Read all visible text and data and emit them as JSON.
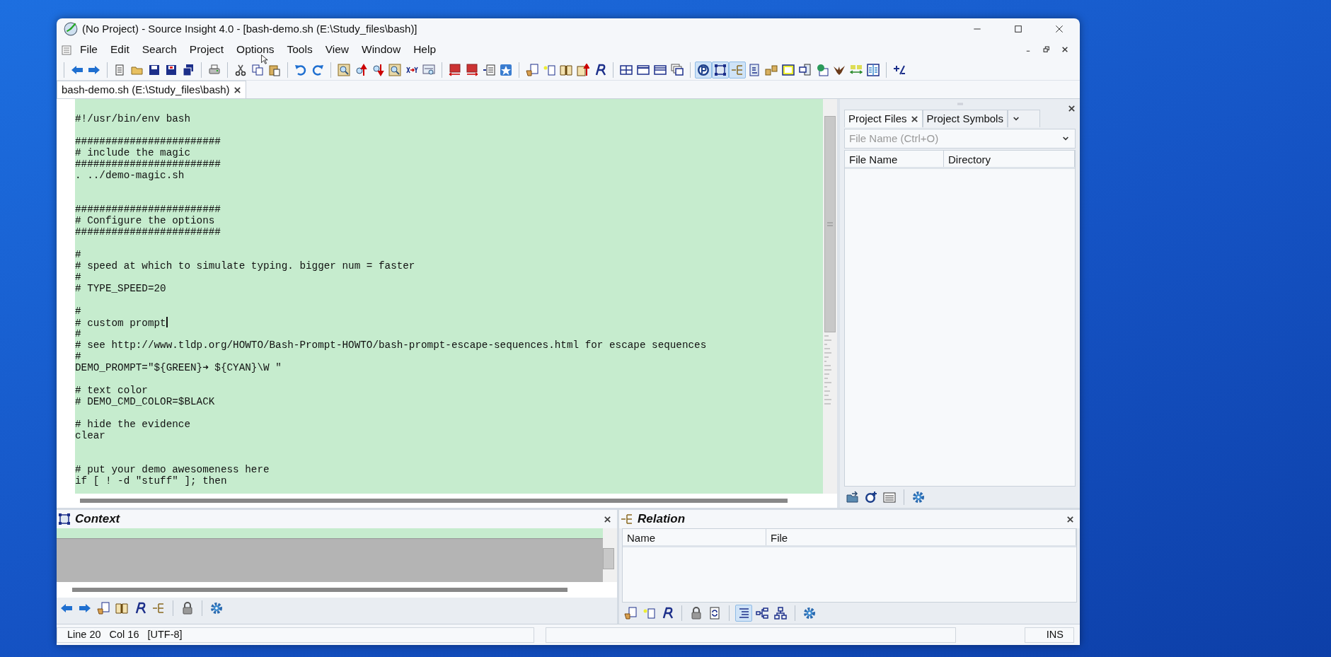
{
  "window": {
    "title": "(No Project) - Source Insight 4.0 - [bash-demo.sh (E:\\Study_files\\bash)]"
  },
  "menu": [
    "File",
    "Edit",
    "Search",
    "Project",
    "Options",
    "Tools",
    "View",
    "Window",
    "Help"
  ],
  "toolbar": [
    [
      {
        "pressed": false
      },
      {
        "pressed": false
      }
    ],
    [
      {
        "pressed": false
      },
      {
        "pressed": false
      },
      {
        "pressed": false
      },
      {
        "pressed": false
      },
      {
        "pressed": false
      }
    ],
    [
      {
        "pressed": false
      }
    ],
    [
      {
        "pressed": false
      },
      {
        "pressed": false
      },
      {
        "pressed": false
      }
    ],
    [
      {
        "pressed": false
      },
      {
        "pressed": false
      }
    ],
    [
      {
        "pressed": false
      },
      {
        "pressed": false
      },
      {
        "pressed": false
      },
      {
        "pressed": false
      },
      {
        "pressed": false
      },
      {
        "pressed": false
      }
    ],
    [
      {
        "pressed": false
      },
      {
        "pressed": false
      },
      {
        "pressed": false
      },
      {
        "pressed": false
      }
    ],
    [
      {
        "pressed": false
      },
      {
        "pressed": false
      },
      {
        "pressed": false
      },
      {
        "pressed": false
      },
      {
        "pressed": false
      }
    ],
    [
      {
        "pressed": false
      },
      {
        "pressed": false
      },
      {
        "pressed": false
      },
      {
        "pressed": false
      }
    ],
    [
      {
        "pressed": true
      },
      {
        "pressed": true
      },
      {
        "pressed": true
      },
      {
        "pressed": false
      },
      {
        "pressed": false
      },
      {
        "pressed": false
      },
      {
        "pressed": false
      },
      {
        "pressed": false
      },
      {
        "pressed": false
      },
      {
        "pressed": false
      },
      {
        "pressed": false
      }
    ],
    [
      {
        "pressed": false
      }
    ]
  ],
  "document_tabs": [
    {
      "label": "bash-demo.sh (E:\\Study_files\\bash)",
      "selected": true
    }
  ],
  "editor": {
    "lines": [
      {
        "kind": "code",
        "text": "#!/usr/bin/env bash",
        "cursor": false
      },
      {
        "kind": "blank"
      },
      {
        "kind": "code",
        "text": "########################",
        "cursor": false
      },
      {
        "kind": "code",
        "text": "# include the magic",
        "cursor": false
      },
      {
        "kind": "code",
        "text": "########################",
        "cursor": false
      },
      {
        "kind": "code",
        "text": ". ../demo-magic.sh",
        "cursor": false
      },
      {
        "kind": "blank"
      },
      {
        "kind": "blank"
      },
      {
        "kind": "code",
        "text": "########################",
        "cursor": false
      },
      {
        "kind": "code",
        "text": "# Configure the options",
        "cursor": false
      },
      {
        "kind": "code",
        "text": "########################",
        "cursor": false
      },
      {
        "kind": "blank"
      },
      {
        "kind": "code",
        "text": "#",
        "cursor": false
      },
      {
        "kind": "code",
        "text": "# speed at which to simulate typing. bigger num = faster",
        "cursor": false
      },
      {
        "kind": "code",
        "text": "#",
        "cursor": false
      },
      {
        "kind": "code",
        "text": "# TYPE_SPEED=20",
        "cursor": false
      },
      {
        "kind": "blank"
      },
      {
        "kind": "code",
        "text": "#",
        "cursor": false
      },
      {
        "kind": "code",
        "text": "# custom prompt",
        "cursor": true
      },
      {
        "kind": "code",
        "text": "#",
        "cursor": false
      },
      {
        "kind": "code",
        "text": "# see http://www.tldp.org/HOWTO/Bash-Prompt-HOWTO/bash-prompt-escape-sequences.html for escape sequences",
        "cursor": false
      },
      {
        "kind": "code",
        "text": "#",
        "cursor": false
      },
      {
        "kind": "code",
        "text": "DEMO_PROMPT=\"${GREEN}➜ ${CYAN}\\W \"",
        "cursor": false
      },
      {
        "kind": "blank"
      },
      {
        "kind": "code",
        "text": "# text color",
        "cursor": false
      },
      {
        "kind": "code",
        "text": "# DEMO_CMD_COLOR=$BLACK",
        "cursor": false
      },
      {
        "kind": "blank"
      },
      {
        "kind": "code",
        "text": "# hide the evidence",
        "cursor": false
      },
      {
        "kind": "code",
        "text": "clear",
        "cursor": false
      },
      {
        "kind": "blank"
      },
      {
        "kind": "blank"
      },
      {
        "kind": "code",
        "text": "# put your demo awesomeness here",
        "cursor": false
      },
      {
        "kind": "code",
        "text": "if [ ! -d \"stuff\" ]; then",
        "cursor": false
      }
    ]
  },
  "project_panel": {
    "tabs": [
      {
        "label": "Project Files",
        "selected": true
      },
      {
        "label": "Project Symbols",
        "selected": false
      }
    ],
    "search": {
      "placeholder": "File Name (Ctrl+O)"
    },
    "columns": [
      "File Name",
      "Directory"
    ]
  },
  "context_panel": {
    "title": "Context"
  },
  "relation_panel": {
    "title": "Relation",
    "columns": [
      "Name",
      "File"
    ]
  },
  "context_toolbar": [
    {
      "pressed": false
    },
    {
      "pressed": false
    },
    {
      "pressed": false
    },
    {
      "pressed": false
    },
    {
      "pressed": false
    },
    {
      "pressed": false
    },
    {
      "pressed": false
    },
    {
      "pressed": false
    }
  ],
  "relation_toolbar": [
    {
      "pressed": false
    },
    {
      "pressed": false
    },
    {
      "pressed": false
    },
    {
      "pressed": false
    },
    {
      "pressed": false
    },
    {
      "pressed": true
    },
    {
      "pressed": false
    },
    {
      "pressed": false
    },
    {
      "pressed": false
    }
  ],
  "status_bar": {
    "line": "Line 20",
    "col": "Col 16",
    "encoding": "[UTF-8]",
    "mode": "INS"
  }
}
